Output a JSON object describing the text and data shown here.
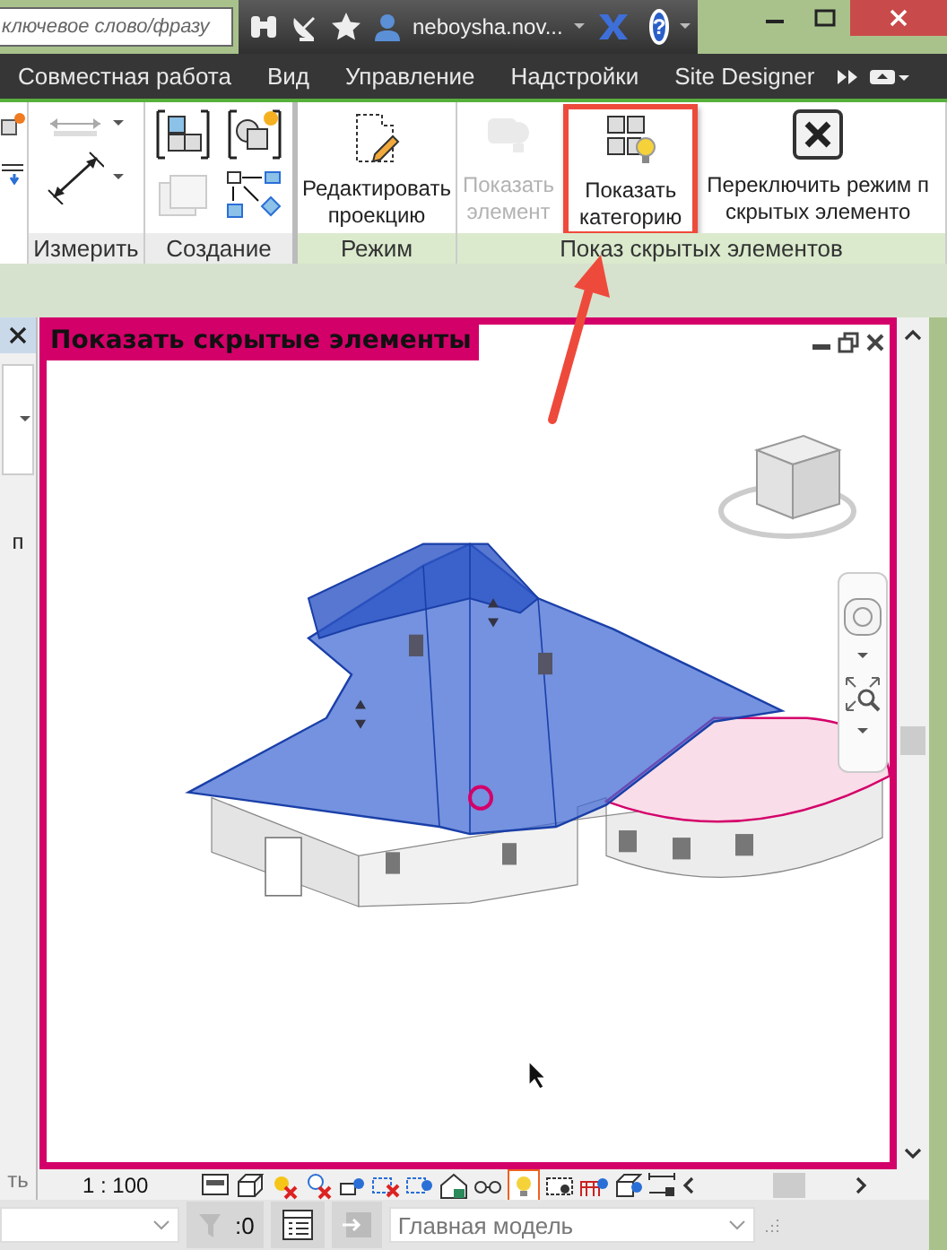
{
  "search": {
    "placeholder": "ключевое слово/фразу"
  },
  "account": {
    "name": "neboysha.nov..."
  },
  "help": {
    "label": "?"
  },
  "tabs": [
    {
      "label": "Совместная работа",
      "selected": false
    },
    {
      "label": "Вид",
      "selected": false
    },
    {
      "label": "Управление",
      "selected": false
    },
    {
      "label": "Надстройки",
      "selected": false
    },
    {
      "label": "Site Designer",
      "selected": false
    }
  ],
  "ribbon": {
    "panels": [
      {
        "kind": "measure",
        "label": "Измерить",
        "contextual": false
      },
      {
        "kind": "create",
        "label": "Создание",
        "contextual": false
      },
      {
        "kind": "buttons",
        "label": "Режим",
        "contextual": true,
        "buttons": [
          {
            "lines": [
              "Редактировать",
              "проекцию"
            ],
            "disabled": false
          }
        ]
      },
      {
        "kind": "buttons",
        "label": "Показ скрытых элементов",
        "contextual": true,
        "buttons": [
          {
            "lines": [
              "Показать",
              "элемент"
            ],
            "disabled": true
          },
          {
            "lines": [
              "Показать",
              "категорию"
            ],
            "disabled": false
          },
          {
            "lines": [
              "Переключить режим п",
              "скрытых элементо"
            ],
            "disabled": false
          }
        ]
      }
    ]
  },
  "left_panel": {
    "texts": [
      "п",
      "ть"
    ]
  },
  "view": {
    "title": "Показать скрытые элементы",
    "scale": "1 : 100",
    "reveal_hidden": true
  },
  "status_bar": {
    "filter_count": ":0",
    "model": "Главная модель"
  }
}
